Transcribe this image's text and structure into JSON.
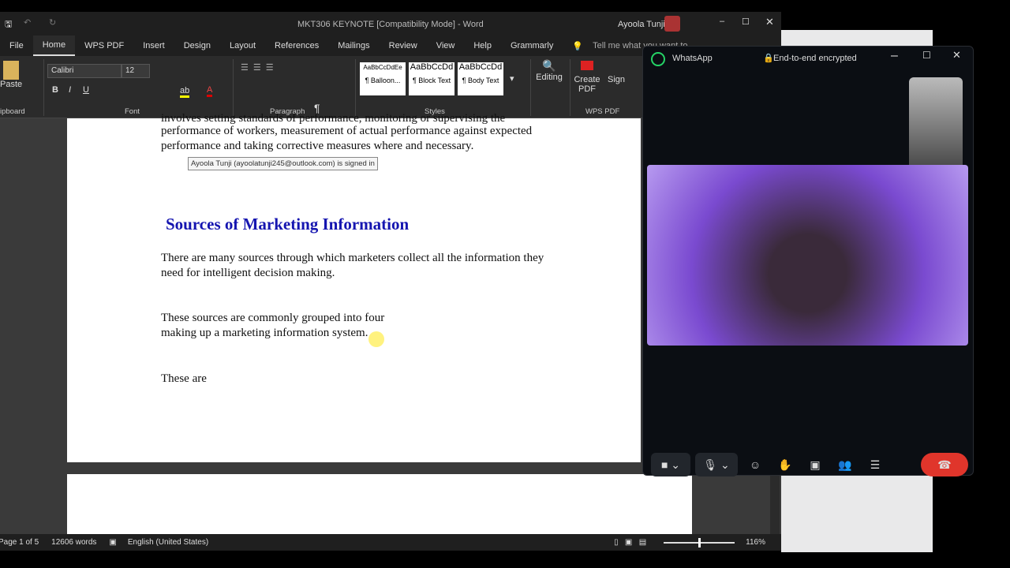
{
  "word": {
    "title": "MKT306 KEYNOTE [Compatibility Mode]  -  Word",
    "user": "Ayoola Tunji",
    "tabs": [
      "File",
      "Home",
      "WPS PDF",
      "Insert",
      "Design",
      "Layout",
      "References",
      "Mailings",
      "Review",
      "View",
      "Help",
      "Grammarly"
    ],
    "tell_me": "Tell me what you want to",
    "font_name": "Calibri",
    "font_size": "12",
    "groups": {
      "clipboard": "ipboard",
      "font": "Font",
      "paragraph": "Paragraph",
      "styles": "Styles",
      "wps": "WPS PDF"
    },
    "paste": "Paste",
    "styles": [
      {
        "preview": "AaBbCcDdEe",
        "name": "¶ Balloon..."
      },
      {
        "preview": "AaBbCcDd",
        "name": "¶ Block Text"
      },
      {
        "preview": "AaBbCcDd",
        "name": "¶ Body Text"
      }
    ],
    "editing": "Editing",
    "create_pdf": "Create PDF",
    "sign": "Sign",
    "doc": {
      "p0a": "involves setting standards of performance, monitoring or supervising the",
      "p0b": "performance of workers, measurement of actual performance against expected",
      "p0c": "performance and taking corrective measures where and necessary.",
      "tooltip": "Ayoola Tunji (ayoolatunji245@outlook.com) is signed in",
      "heading": "Sources of Marketing Information",
      "p1a": "There are many sources through which marketers collect all the information they",
      "p1b": "need for intelligent decision making.",
      "p2a": "These sources are commonly grouped into four",
      "p2b": "making up a marketing information system.",
      "p3": "These are"
    },
    "status": {
      "page": "Page 1 of 5",
      "words": "12606 words",
      "language": "English (United States)",
      "zoom": "116%"
    }
  },
  "whatsapp": {
    "app": "WhatsApp",
    "encryption": "End-to-end encrypted",
    "accent": "#25d366",
    "end_call_color": "#e0352b"
  }
}
